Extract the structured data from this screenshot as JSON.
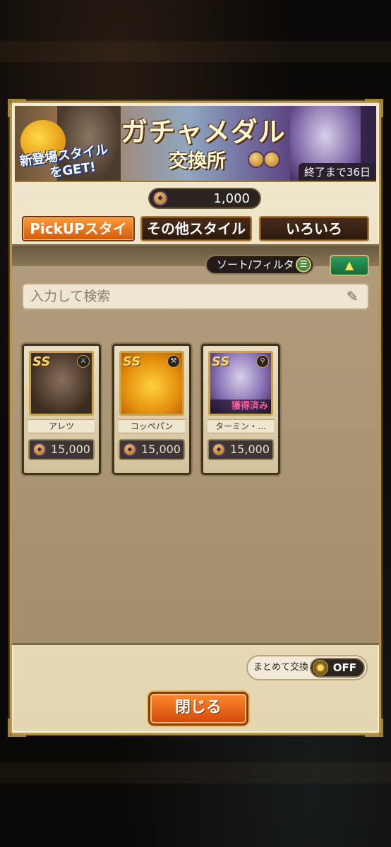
{
  "banner": {
    "title": "ガチャメダル",
    "subtitle": "交換所",
    "tagline_1": "新登場スタイル",
    "tagline_2": "をGET!",
    "deadline": "終了まで36日"
  },
  "medal": {
    "count": "1,000",
    "icon": "gacha-medal-icon"
  },
  "tabs": [
    {
      "label": "PickUPスタイル",
      "active": true
    },
    {
      "label": "その他スタイル",
      "active": false
    },
    {
      "label": "いろいろ",
      "active": false
    }
  ],
  "toolbar": {
    "sort_label": "ソート/フィルタ"
  },
  "search": {
    "placeholder": "入力して検索"
  },
  "items": [
    {
      "name": "アレツ",
      "rank": "SS",
      "cost": "15,000",
      "owned": false,
      "weapon_icon": "sword-icon"
    },
    {
      "name": "コッペパン",
      "rank": "SS",
      "cost": "15,000",
      "owned": false,
      "weapon_icon": "axe-icon"
    },
    {
      "name": "ターミン・…",
      "rank": "SS",
      "cost": "15,000",
      "owned": true,
      "owned_label": "獲得済み",
      "weapon_icon": "staff-icon"
    }
  ],
  "bulk_exchange": {
    "label": "まとめて交換",
    "state": "OFF"
  },
  "close_button": {
    "label": "閉じる"
  },
  "colors": {
    "active_tab": "#e8741e",
    "inactive_tab": "#3a2314",
    "dialog_bg": "#eae0c4",
    "panel_bg": "#a8946f",
    "close_button": "#e5631a"
  }
}
